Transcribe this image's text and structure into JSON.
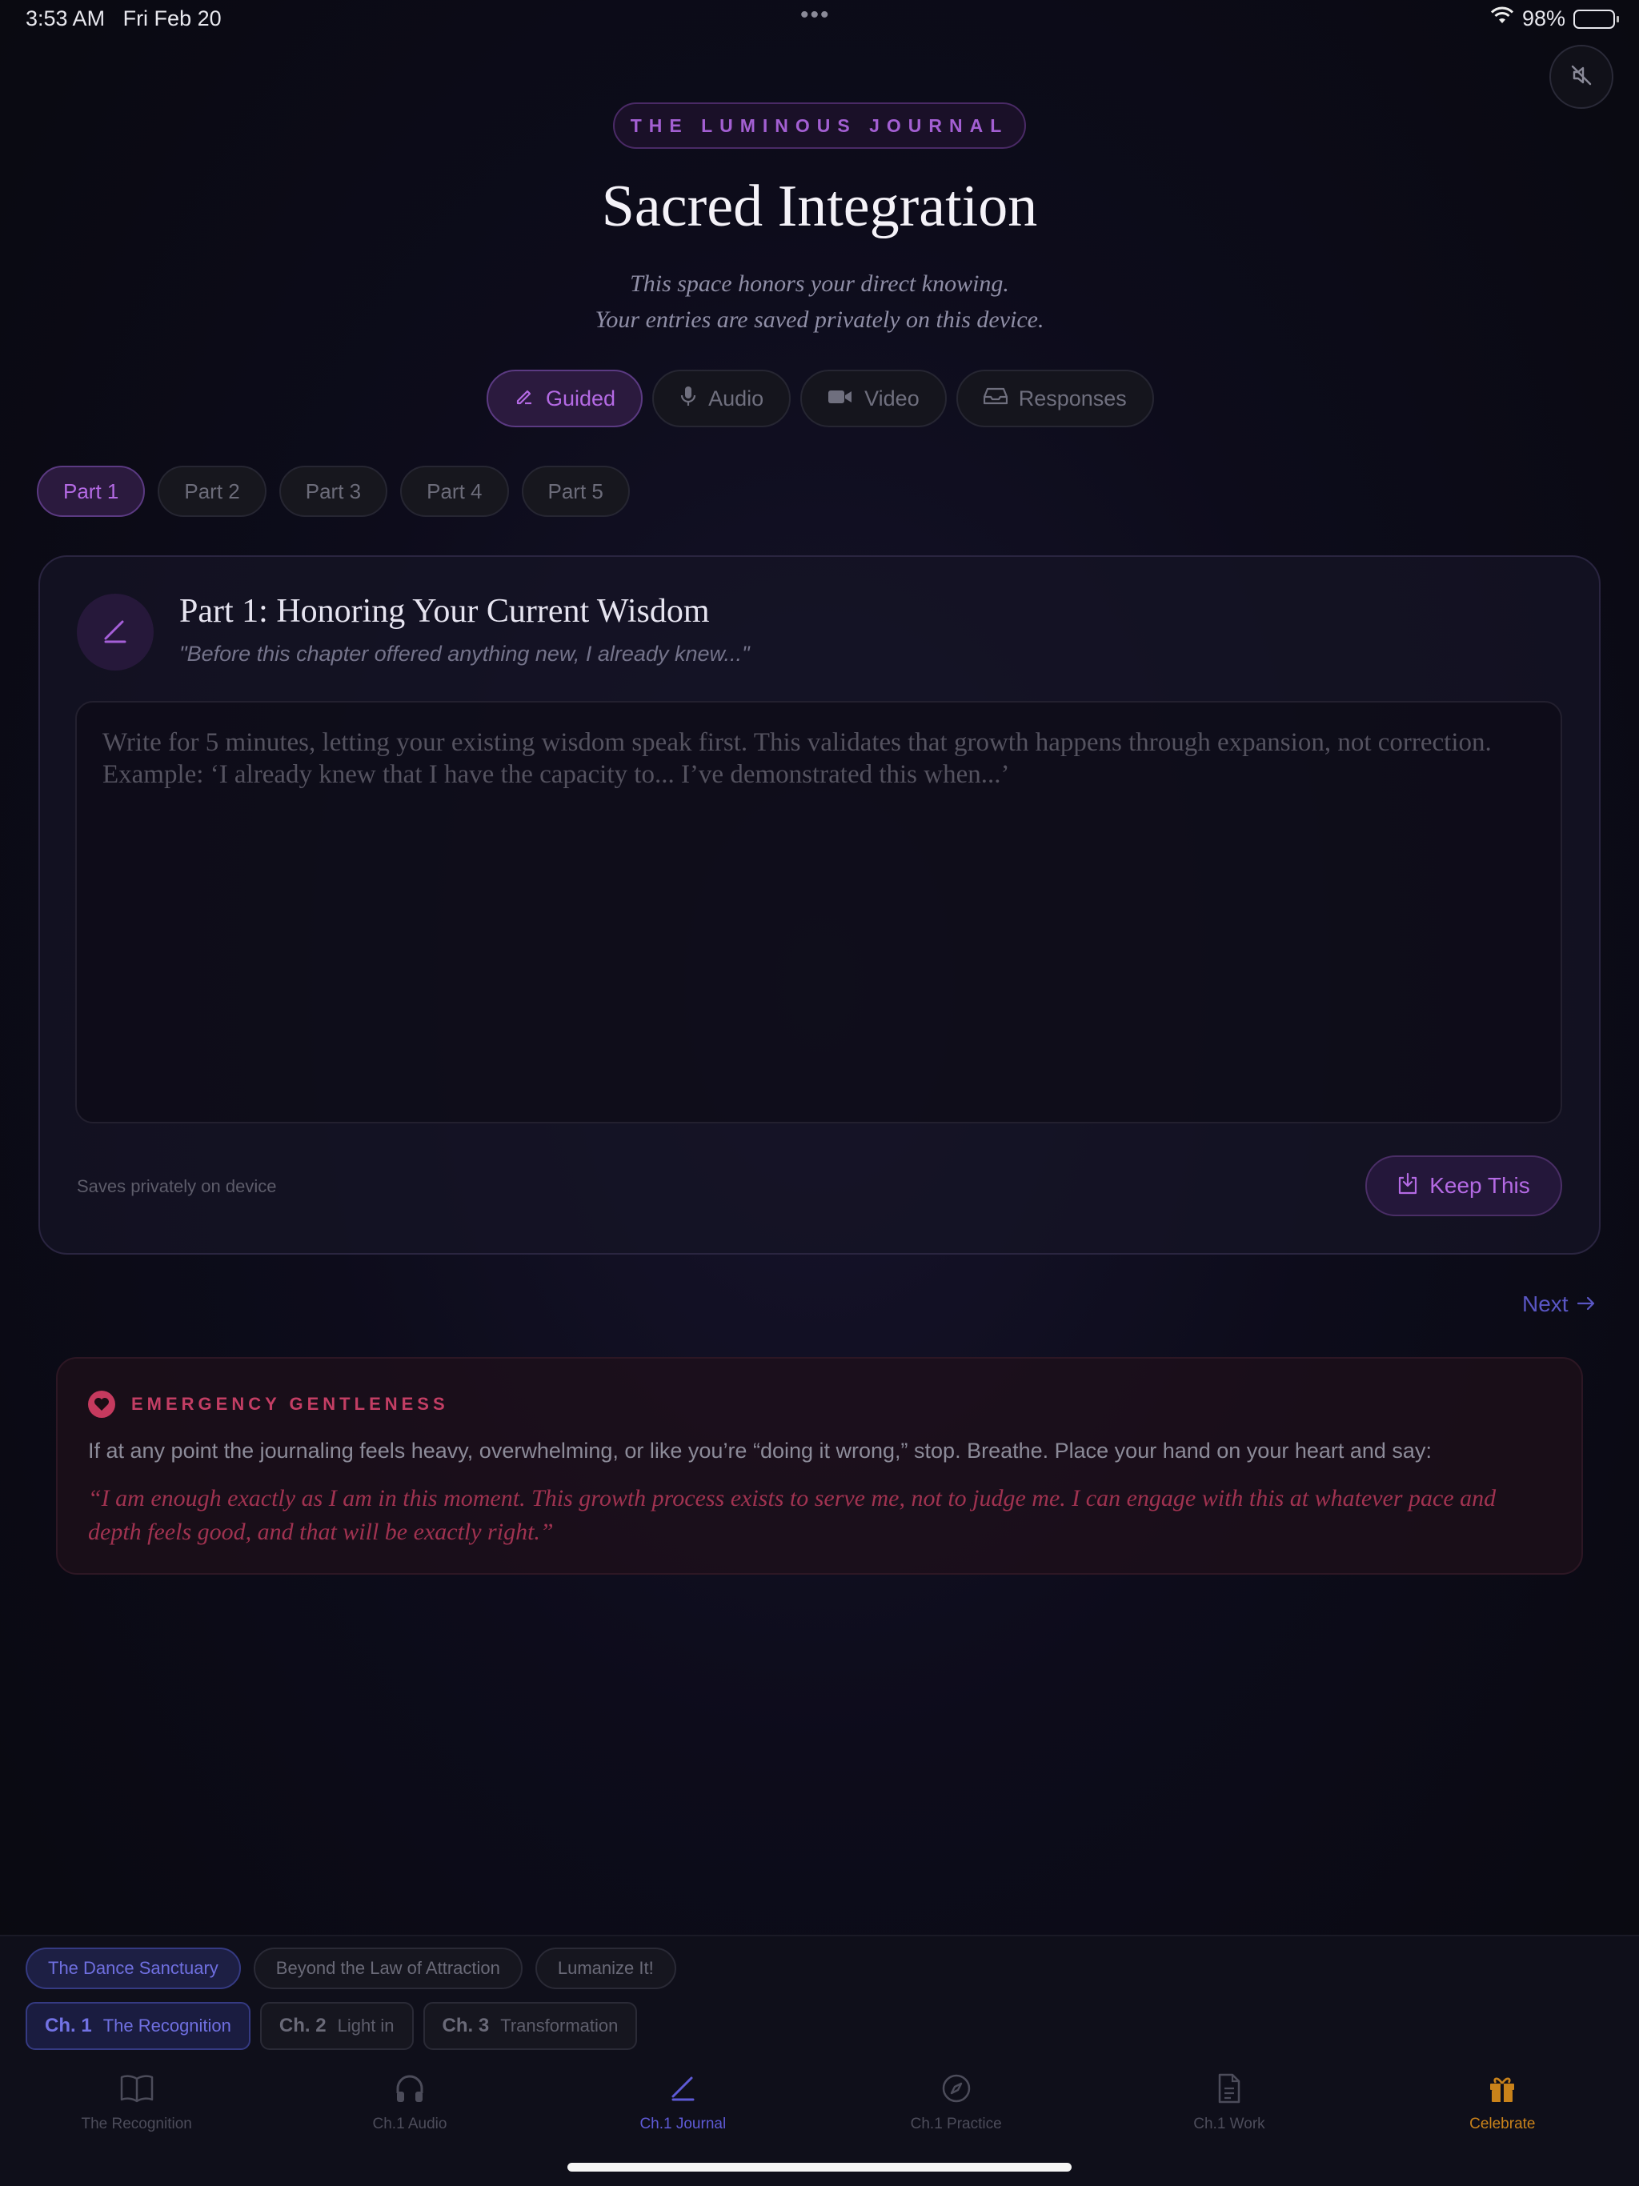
{
  "status_bar": {
    "time": "3:53 AM",
    "date": "Fri Feb 20",
    "battery": "98%",
    "wifi_icon": "wifi-icon",
    "battery_level": 0.98
  },
  "header": {
    "journal_label": "THE LUMINOUS JOURNAL",
    "title": "Sacred Integration",
    "subtitle_line1": "This space honors your direct knowing.",
    "subtitle_line2": "Your entries are saved privately on this device."
  },
  "mode_tabs": [
    {
      "label": "Guided",
      "icon": "pen-icon",
      "active": true
    },
    {
      "label": "Audio",
      "icon": "microphone-icon",
      "active": false
    },
    {
      "label": "Video",
      "icon": "video-camera-icon",
      "active": false
    },
    {
      "label": "Responses",
      "icon": "inbox-icon",
      "active": false
    }
  ],
  "part_tabs": [
    {
      "label": "Part 1",
      "active": true
    },
    {
      "label": "Part 2",
      "active": false
    },
    {
      "label": "Part 3",
      "active": false
    },
    {
      "label": "Part 4",
      "active": false
    },
    {
      "label": "Part 5",
      "active": false
    }
  ],
  "card": {
    "title": "Part 1: Honoring Your Current Wisdom",
    "subtitle": "\"Before this chapter offered anything new, I already knew...\"",
    "placeholder": "Write for 5 minutes, letting your existing wisdom speak first. This validates that growth happens through expansion, not correction. Example: ‘I already knew that I have the capacity to... I’ve demonstrated this when...’",
    "value": "",
    "saves_note": "Saves privately on device",
    "keep_label": "Keep This"
  },
  "next_label": "Next",
  "emergency": {
    "label": "EMERGENCY GENTLENESS",
    "text": "If at any point the journaling feels heavy, overwhelming, or like you’re “doing it wrong,” stop. Breathe. Place your hand on your heart and say:",
    "quote": "“I am enough exactly as I am in this moment. This growth process exists to serve me, not to judge me. I can engage with this at whatever pace and depth feels good, and that will be exactly right.”"
  },
  "courses": [
    {
      "label": "The Dance Sanctuary",
      "active": true
    },
    {
      "label": "Beyond the Law of Attraction",
      "active": false
    },
    {
      "label": "Lumanize It!",
      "active": false
    }
  ],
  "chapters": [
    {
      "num": "Ch. 1",
      "label": "The Recognition",
      "active": true
    },
    {
      "num": "Ch. 2",
      "label": "Light in",
      "active": false
    },
    {
      "num": "Ch. 3",
      "label": "Transformation",
      "active": false
    }
  ],
  "tabbar": [
    {
      "label": "The Recognition",
      "icon": "book-icon"
    },
    {
      "label": "Ch.1 Audio",
      "icon": "headphones-icon"
    },
    {
      "label": "Ch.1 Journal",
      "icon": "pen-icon",
      "active": true
    },
    {
      "label": "Ch.1 Practice",
      "icon": "compass-icon"
    },
    {
      "label": "Ch.1 Work",
      "icon": "document-icon"
    },
    {
      "label": "Celebrate",
      "icon": "gift-icon"
    }
  ],
  "colors": {
    "accent_purple": "#b46ae4",
    "accent_indigo": "#5e5ad6",
    "emergency_red": "#c33e64",
    "celebrate_gold": "#c9821a"
  }
}
